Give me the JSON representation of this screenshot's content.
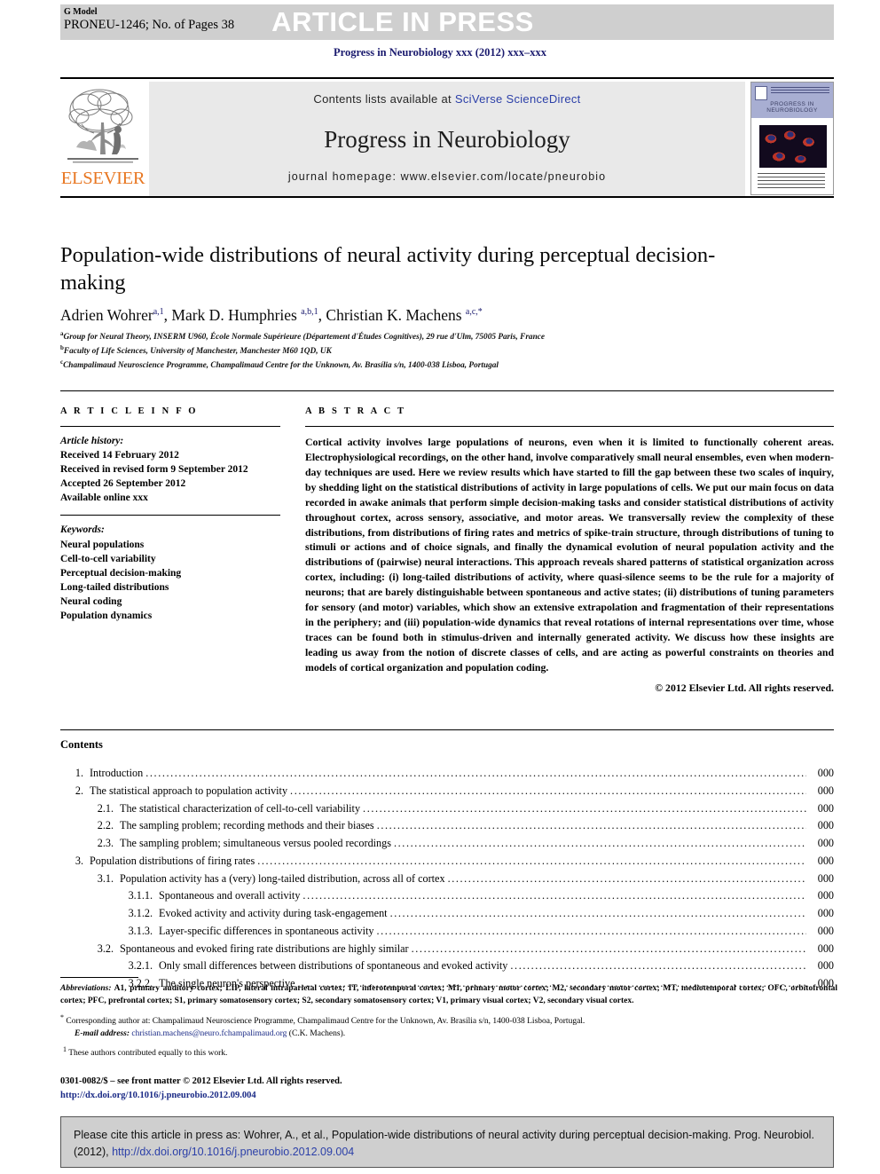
{
  "banner": {
    "g_model": "G Model",
    "article_id": "PRONEU-1246; No. of Pages 38",
    "article_in_press": "ARTICLE IN PRESS"
  },
  "journal_line": "Progress in Neurobiology xxx (2012) xxx–xxx",
  "masthead": {
    "publisher": "ELSEVIER",
    "contents_prefix": "Contents lists available at ",
    "contents_link": "SciVerse ScienceDirect",
    "journal_title": "Progress in Neurobiology",
    "homepage": "journal homepage: www.elsevier.com/locate/pneurobio",
    "cover_title": "PROGRESS IN NEUROBIOLOGY"
  },
  "article": {
    "title": "Population-wide distributions of neural activity during perceptual decision-making",
    "authors": [
      {
        "name": "Adrien Wohrer",
        "sup": "a,1",
        "sep": ", "
      },
      {
        "name": "Mark D. Humphries ",
        "sup": "a,b,1",
        "sep": ", "
      },
      {
        "name": "Christian K. Machens ",
        "sup": "a,c,*",
        "sep": ""
      }
    ],
    "affiliations": [
      {
        "mark": "a",
        "text": "Group for Neural Theory, INSERM U960, École Normale Supérieure (Département d'Études Cognitives), 29 rue d'Ulm, 75005 Paris, France"
      },
      {
        "mark": "b",
        "text": "Faculty of Life Sciences, University of Manchester, Manchester M60 1QD, UK"
      },
      {
        "mark": "c",
        "text": "Champalimaud Neuroscience Programme, Champalimaud Centre for the Unknown, Av. Brasília s/n, 1400-038 Lisboa, Portugal"
      }
    ]
  },
  "article_info": {
    "heading": "A R T I C L E   I N F O",
    "history_label": "Article history:",
    "history": [
      "Received 14 February 2012",
      "Received in revised form 9 September 2012",
      "Accepted 26 September 2012",
      "Available online xxx"
    ],
    "keywords_label": "Keywords:",
    "keywords": [
      "Neural populations",
      "Cell-to-cell variability",
      "Perceptual decision-making",
      "Long-tailed distributions",
      "Neural coding",
      "Population dynamics"
    ]
  },
  "abstract": {
    "heading": "A B S T R A C T",
    "body": "Cortical activity involves large populations of neurons, even when it is limited to functionally coherent areas. Electrophysiological recordings, on the other hand, involve comparatively small neural ensembles, even when modern-day techniques are used. Here we review results which have started to fill the gap between these two scales of inquiry, by shedding light on the statistical distributions of activity in large populations of cells. We put our main focus on data recorded in awake animals that perform simple decision-making tasks and consider statistical distributions of activity throughout cortex, across sensory, associative, and motor areas. We transversally review the complexity of these distributions, from distributions of firing rates and metrics of spike-train structure, through distributions of tuning to stimuli or actions and of choice signals, and finally the dynamical evolution of neural population activity and the distributions of (pairwise) neural interactions. This approach reveals shared patterns of statistical organization across cortex, including: (i) long-tailed distributions of activity, where quasi-silence seems to be the rule for a majority of neurons; that are barely distinguishable between spontaneous and active states; (ii) distributions of tuning parameters for sensory (and motor) variables, which show an extensive extrapolation and fragmentation of their representations in the periphery; and (iii) population-wide dynamics that reveal rotations of internal representations over time, whose traces can be found both in stimulus-driven and internally generated activity. We discuss how these insights are leading us away from the notion of discrete classes of cells, and are acting as powerful constraints on theories and models of cortical organization and population coding.",
    "copyright": "© 2012 Elsevier Ltd. All rights reserved."
  },
  "contents": {
    "heading": "Contents",
    "entries": [
      {
        "level": 1,
        "num": "1.",
        "label": "Introduction",
        "page": "000"
      },
      {
        "level": 1,
        "num": "2.",
        "label": "The statistical approach to population activity",
        "page": "000"
      },
      {
        "level": 2,
        "num": "2.1.",
        "label": "The statistical characterization of cell-to-cell variability",
        "page": "000"
      },
      {
        "level": 2,
        "num": "2.2.",
        "label": "The sampling problem; recording methods and their biases",
        "page": "000"
      },
      {
        "level": 2,
        "num": "2.3.",
        "label": "The sampling problem; simultaneous versus pooled recordings",
        "page": "000"
      },
      {
        "level": 1,
        "num": "3.",
        "label": "Population distributions of firing rates",
        "page": "000"
      },
      {
        "level": 2,
        "num": "3.1.",
        "label": "Population activity has a (very) long-tailed distribution, across all of cortex",
        "page": "000"
      },
      {
        "level": 3,
        "num": "3.1.1.",
        "label": "Spontaneous and overall activity",
        "page": "000"
      },
      {
        "level": 3,
        "num": "3.1.2.",
        "label": "Evoked activity and activity during task-engagement",
        "page": "000"
      },
      {
        "level": 3,
        "num": "3.1.3.",
        "label": "Layer-specific differences in spontaneous activity",
        "page": "000"
      },
      {
        "level": 2,
        "num": "3.2.",
        "label": "Spontaneous and evoked firing rate distributions are highly similar",
        "page": "000"
      },
      {
        "level": 3,
        "num": "3.2.1.",
        "label": "Only small differences between distributions of spontaneous and evoked activity",
        "page": "000"
      },
      {
        "level": 3,
        "num": "3.2.2.",
        "label": "The single neuron's perspective",
        "page": "000"
      }
    ]
  },
  "footnotes": {
    "abbrev_label": "Abbreviations:",
    "abbrev_text": " A1, primary auditory cortex; LIP, lateral intraparietal cortex; IT, inferotemporal cortex; M1, primary motor cortex; M2, secondary motor cortex; MT, mediotemporal cortex; OFC, orbitofrontal cortex; PFC, prefrontal cortex; S1, primary somatosensory cortex; S2, secondary somatosensory cortex; V1, primary visual cortex; V2, secondary visual cortex.",
    "corresponding_mark": "*",
    "corresponding": "Corresponding author at: Champalimaud Neuroscience Programme, Champalimaud Centre for the Unknown, Av. Brasília s/n, 1400-038 Lisboa, Portugal.",
    "email_label": "E-mail address:",
    "email": "christian.machens@neuro.fchampalimaud.org",
    "email_suffix": " (C.K. Machens).",
    "equal_mark": "1",
    "equal_contrib": "These authors contributed equally to this work."
  },
  "frontmatter": {
    "line1": "0301-0082/$ – see front matter © 2012 Elsevier Ltd. All rights reserved.",
    "doi": "http://dx.doi.org/10.1016/j.pneurobio.2012.09.004"
  },
  "cite_box": {
    "text": "Please cite this article in press as: Wohrer, A., et al., Population-wide distributions of neural activity during perceptual decision-making. Prog. Neurobiol. (2012), ",
    "doi": "http://dx.doi.org/10.1016/j.pneurobio.2012.09.004"
  },
  "colors": {
    "banner_bg": "#cfcfcf",
    "link_blue": "#2b3fa8",
    "journal_navy": "#1a1a6e",
    "elsevier_orange": "#E87722"
  }
}
